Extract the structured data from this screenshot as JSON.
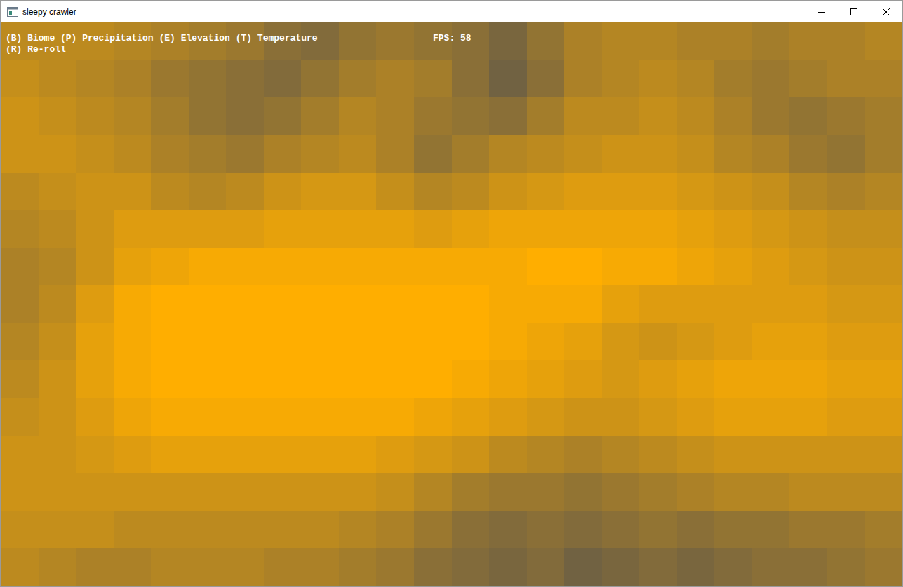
{
  "window": {
    "title": "sleepy crawler"
  },
  "hud": {
    "lines": [
      "(B) Biome (P) Precipitation (E) Elevation (T) Temperature",
      "(R) Re-roll"
    ],
    "fps": "FPS: 58"
  },
  "map": {
    "levels": [
      [
        0.6,
        0.6,
        0.6,
        0.55,
        0.5,
        0.45,
        0.4,
        0.3,
        0.25,
        0.35,
        0.4,
        0.35,
        0.3,
        0.2,
        0.35,
        0.5,
        0.55,
        0.55,
        0.5,
        0.5,
        0.45,
        0.5,
        0.5,
        0.55
      ],
      [
        0.65,
        0.6,
        0.55,
        0.5,
        0.4,
        0.35,
        0.3,
        0.25,
        0.35,
        0.45,
        0.5,
        0.45,
        0.3,
        0.15,
        0.3,
        0.5,
        0.55,
        0.6,
        0.55,
        0.45,
        0.4,
        0.45,
        0.5,
        0.5
      ],
      [
        0.7,
        0.65,
        0.6,
        0.55,
        0.45,
        0.35,
        0.3,
        0.35,
        0.45,
        0.55,
        0.5,
        0.4,
        0.35,
        0.3,
        0.45,
        0.6,
        0.6,
        0.65,
        0.6,
        0.5,
        0.4,
        0.35,
        0.4,
        0.45
      ],
      [
        0.7,
        0.7,
        0.65,
        0.6,
        0.5,
        0.45,
        0.4,
        0.5,
        0.55,
        0.6,
        0.5,
        0.35,
        0.45,
        0.55,
        0.6,
        0.65,
        0.7,
        0.7,
        0.65,
        0.55,
        0.5,
        0.4,
        0.35,
        0.45
      ],
      [
        0.6,
        0.65,
        0.7,
        0.7,
        0.6,
        0.55,
        0.6,
        0.7,
        0.75,
        0.75,
        0.65,
        0.55,
        0.6,
        0.7,
        0.75,
        0.8,
        0.8,
        0.8,
        0.75,
        0.7,
        0.65,
        0.55,
        0.5,
        0.55
      ],
      [
        0.55,
        0.6,
        0.7,
        0.8,
        0.8,
        0.8,
        0.8,
        0.85,
        0.85,
        0.85,
        0.85,
        0.8,
        0.85,
        0.9,
        0.9,
        0.9,
        0.9,
        0.9,
        0.85,
        0.8,
        0.75,
        0.7,
        0.65,
        0.65
      ],
      [
        0.5,
        0.55,
        0.7,
        0.85,
        0.9,
        0.95,
        0.95,
        0.95,
        0.95,
        0.95,
        0.95,
        0.95,
        0.95,
        0.95,
        1,
        1,
        0.95,
        0.95,
        0.9,
        0.85,
        0.8,
        0.75,
        0.7,
        0.7
      ],
      [
        0.5,
        0.6,
        0.8,
        0.95,
        1,
        1,
        1,
        1,
        1,
        1,
        1,
        1,
        1,
        0.95,
        0.95,
        0.95,
        0.85,
        0.8,
        0.8,
        0.8,
        0.8,
        0.8,
        0.75,
        0.75
      ],
      [
        0.55,
        0.65,
        0.85,
        0.95,
        1,
        1,
        1,
        1,
        1,
        1,
        1,
        1,
        1,
        0.95,
        0.9,
        0.85,
        0.75,
        0.7,
        0.75,
        0.8,
        0.85,
        0.85,
        0.8,
        0.8
      ],
      [
        0.6,
        0.7,
        0.85,
        0.95,
        1,
        1,
        1,
        1,
        1,
        1,
        1,
        1,
        0.95,
        0.9,
        0.85,
        0.8,
        0.75,
        0.8,
        0.85,
        0.9,
        0.9,
        0.9,
        0.85,
        0.85
      ],
      [
        0.65,
        0.7,
        0.8,
        0.9,
        0.95,
        0.95,
        0.95,
        0.95,
        0.95,
        0.95,
        0.95,
        0.9,
        0.85,
        0.8,
        0.75,
        0.7,
        0.7,
        0.75,
        0.8,
        0.85,
        0.85,
        0.85,
        0.8,
        0.8
      ],
      [
        0.7,
        0.7,
        0.75,
        0.8,
        0.85,
        0.85,
        0.85,
        0.85,
        0.85,
        0.85,
        0.8,
        0.75,
        0.7,
        0.6,
        0.55,
        0.5,
        0.55,
        0.6,
        0.65,
        0.7,
        0.7,
        0.7,
        0.7,
        0.7
      ],
      [
        0.7,
        0.7,
        0.7,
        0.7,
        0.7,
        0.7,
        0.7,
        0.7,
        0.7,
        0.7,
        0.65,
        0.55,
        0.45,
        0.4,
        0.4,
        0.35,
        0.4,
        0.45,
        0.5,
        0.55,
        0.55,
        0.6,
        0.6,
        0.6
      ],
      [
        0.65,
        0.65,
        0.65,
        0.6,
        0.6,
        0.6,
        0.6,
        0.6,
        0.6,
        0.55,
        0.5,
        0.4,
        0.3,
        0.25,
        0.3,
        0.25,
        0.3,
        0.35,
        0.3,
        0.35,
        0.35,
        0.4,
        0.4,
        0.45
      ],
      [
        0.6,
        0.55,
        0.5,
        0.5,
        0.55,
        0.55,
        0.55,
        0.5,
        0.5,
        0.45,
        0.4,
        0.3,
        0.25,
        0.2,
        0.25,
        0.15,
        0.2,
        0.25,
        0.2,
        0.25,
        0.3,
        0.3,
        0.35,
        0.4
      ]
    ]
  }
}
